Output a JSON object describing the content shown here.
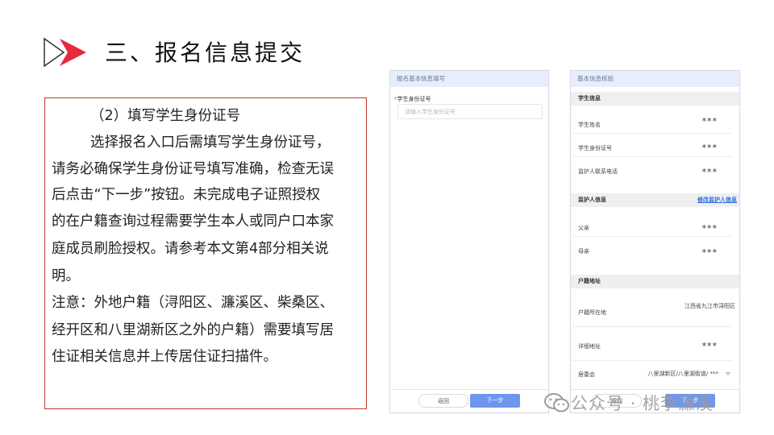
{
  "slide": {
    "title": "三、报名信息提交",
    "paragraph_lines": [
      "（2）填写学生身份证号",
      "选择报名入口后需填写学生身份证号，",
      "请务必确保学生身份证号填写准确，检查无误",
      "后点击“下一步”按钮。未完成电子证照授权",
      "的在户籍查询过程需要学生本人或同户口本家",
      "庭成员刷脸授权。请参考本文第4部分相关说",
      "明。",
      "注意：外地户籍（浔阳区、濂溪区、柴桑区、",
      "经开区和八里湖新区之外的户籍）需要填写居",
      "住证相关信息并上传居住证扫描件。"
    ]
  },
  "form_panel": {
    "header": "报名基本信息填写",
    "required_mark": "*",
    "field_label": "学生身份证号",
    "field_placeholder": "请输入学生身份证号",
    "back_label": "返回",
    "next_label": "下一步"
  },
  "verify_panel": {
    "header": "基本信息核验",
    "student_section": "学生信息",
    "student_rows": [
      {
        "label": "学生姓名",
        "value": "***"
      },
      {
        "label": "学生身份证号",
        "value": "***"
      },
      {
        "label": "监护人联系电话",
        "value": "***"
      }
    ],
    "guardian_section": "监护人信息",
    "guardian_link": "修改监护人信息",
    "guardian_rows": [
      {
        "label": "父亲",
        "value": "***"
      },
      {
        "label": "母亲",
        "value": "***"
      }
    ],
    "address_section": "户籍地址",
    "address_rows": [
      {
        "label": "户籍所在地",
        "value": "江西省九江市浔阳区"
      },
      {
        "label": "详细地址",
        "value": "***"
      },
      {
        "label": "居委会",
        "value": "八里湖新区/八里湖街道/ ***"
      }
    ],
    "back_label": "返回",
    "next_label": "下一步"
  },
  "watermark": {
    "text": "公众号 · 桃李濂溪"
  },
  "colors": {
    "accent_red": "#e8283c",
    "border_red": "#c0392b",
    "primary_blue": "#6f96ee",
    "link_blue": "#2f6fe0"
  }
}
